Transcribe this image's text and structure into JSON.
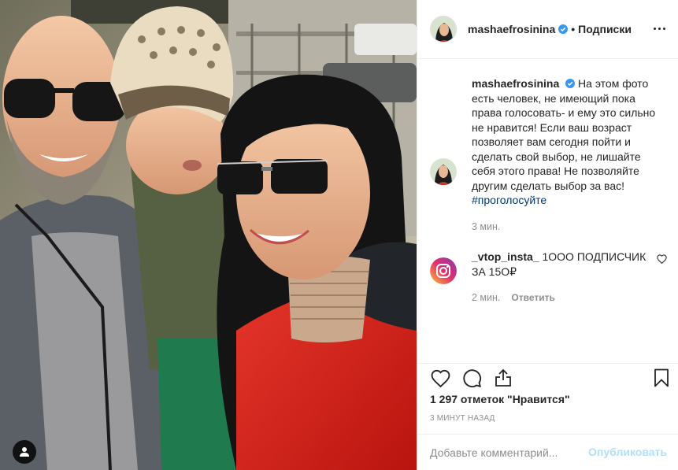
{
  "post": {
    "photo_alt": "",
    "author": {
      "username": "mashaefrosinina",
      "verified": true,
      "separator": "•",
      "follow_label": "Подписки"
    },
    "caption": {
      "username": "mashaefrosinina",
      "text": "На этом фото есть человек, не имеющий пока права голосовать- и ему это сильно не нравится! Если ваш возраст позволяет вам сегодня пойти и сделать свой выбор, не лишайте себя этого права! Не позволяйте другим сделать выбор за вас!",
      "hashtag": "#проголосуйте",
      "time": "3 мин."
    },
    "comments": [
      {
        "username": "_vtop_insta_",
        "text": "1ООО ПОДПИСЧИК ЗА 15О₽",
        "time": "2 мин.",
        "reply_label": "Ответить"
      }
    ],
    "likes_text": "1 297 отметок \"Нравится\"",
    "time_ago": "3 МИНУТ НАЗАД",
    "add_comment": {
      "placeholder": "Добавьте комментарий...",
      "post_label": "Опубликовать"
    }
  },
  "icons": {
    "tag": "user-tag-icon",
    "more": "more-options-icon",
    "verified": "verified-badge-icon",
    "like": "heart-icon",
    "comment": "comment-icon",
    "share": "share-icon",
    "save": "bookmark-icon"
  },
  "colors": {
    "text": "#262626",
    "muted": "#8e8e8e",
    "link": "#00376b",
    "verified": "#3897f0",
    "post_disabled": "#b2dffc",
    "border": "#efefef"
  }
}
